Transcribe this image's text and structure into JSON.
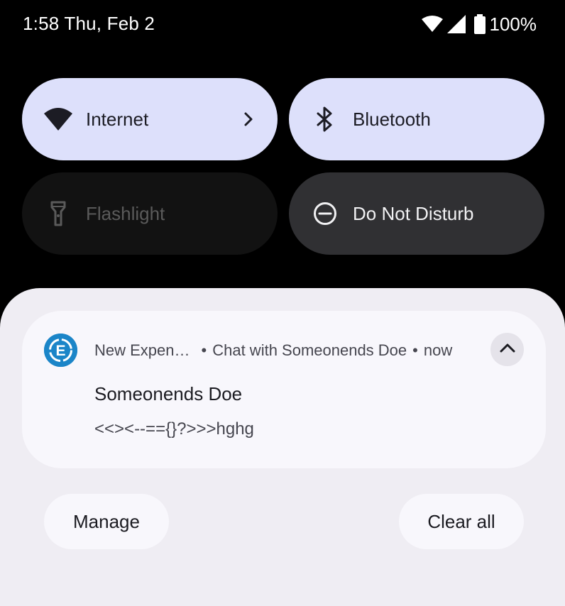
{
  "status_bar": {
    "time_date": "1:58 Thu, Feb 2",
    "battery_percent": "100%",
    "icons": [
      "wifi-icon",
      "cellular-signal-icon",
      "battery-icon"
    ]
  },
  "quick_settings": {
    "tiles": [
      {
        "label": "Internet",
        "icon": "wifi-icon",
        "state": "on",
        "has_chevron": true
      },
      {
        "label": "Bluetooth",
        "icon": "bluetooth-icon",
        "state": "on"
      },
      {
        "label": "Flashlight",
        "icon": "flashlight-icon",
        "state": "unavailable"
      },
      {
        "label": "Do Not Disturb",
        "icon": "do-not-disturb-icon",
        "state": "off"
      }
    ]
  },
  "notification": {
    "app_name": "New Expen…",
    "app_icon": "app-logo-icon",
    "app_icon_letter": "E",
    "channel": "Chat with Someonends Doe",
    "separator": "•",
    "time": "now",
    "title": "Someonends Doe",
    "text": "<<><--=={}?>>>hghg"
  },
  "actions": {
    "manage_label": "Manage",
    "clear_all_label": "Clear all"
  },
  "colors": {
    "tile_on": "#dde0fb",
    "tile_off": "#121212",
    "tile_dark": "#303033",
    "shade_bg": "#efedf3",
    "card_bg": "#f8f7fc",
    "app_icon_bg": "#1b85c8"
  }
}
